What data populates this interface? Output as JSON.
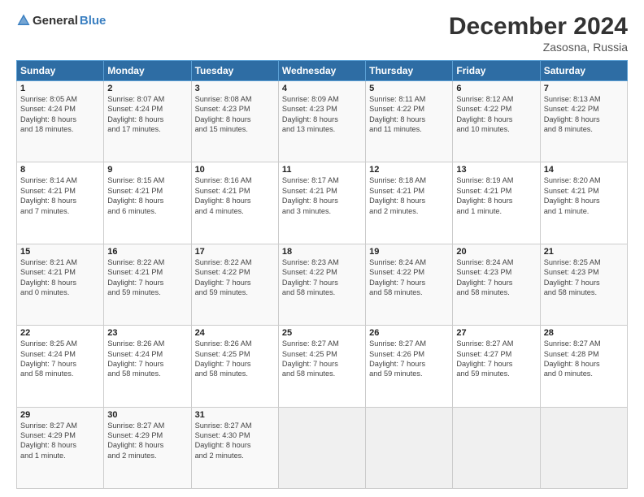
{
  "logo": {
    "general": "General",
    "blue": "Blue"
  },
  "title": "December 2024",
  "subtitle": "Zasosna, Russia",
  "headers": [
    "Sunday",
    "Monday",
    "Tuesday",
    "Wednesday",
    "Thursday",
    "Friday",
    "Saturday"
  ],
  "weeks": [
    [
      {
        "day": "1",
        "info": "Sunrise: 8:05 AM\nSunset: 4:24 PM\nDaylight: 8 hours\nand 18 minutes."
      },
      {
        "day": "2",
        "info": "Sunrise: 8:07 AM\nSunset: 4:24 PM\nDaylight: 8 hours\nand 17 minutes."
      },
      {
        "day": "3",
        "info": "Sunrise: 8:08 AM\nSunset: 4:23 PM\nDaylight: 8 hours\nand 15 minutes."
      },
      {
        "day": "4",
        "info": "Sunrise: 8:09 AM\nSunset: 4:23 PM\nDaylight: 8 hours\nand 13 minutes."
      },
      {
        "day": "5",
        "info": "Sunrise: 8:11 AM\nSunset: 4:22 PM\nDaylight: 8 hours\nand 11 minutes."
      },
      {
        "day": "6",
        "info": "Sunrise: 8:12 AM\nSunset: 4:22 PM\nDaylight: 8 hours\nand 10 minutes."
      },
      {
        "day": "7",
        "info": "Sunrise: 8:13 AM\nSunset: 4:22 PM\nDaylight: 8 hours\nand 8 minutes."
      }
    ],
    [
      {
        "day": "8",
        "info": "Sunrise: 8:14 AM\nSunset: 4:21 PM\nDaylight: 8 hours\nand 7 minutes."
      },
      {
        "day": "9",
        "info": "Sunrise: 8:15 AM\nSunset: 4:21 PM\nDaylight: 8 hours\nand 6 minutes."
      },
      {
        "day": "10",
        "info": "Sunrise: 8:16 AM\nSunset: 4:21 PM\nDaylight: 8 hours\nand 4 minutes."
      },
      {
        "day": "11",
        "info": "Sunrise: 8:17 AM\nSunset: 4:21 PM\nDaylight: 8 hours\nand 3 minutes."
      },
      {
        "day": "12",
        "info": "Sunrise: 8:18 AM\nSunset: 4:21 PM\nDaylight: 8 hours\nand 2 minutes."
      },
      {
        "day": "13",
        "info": "Sunrise: 8:19 AM\nSunset: 4:21 PM\nDaylight: 8 hours\nand 1 minute."
      },
      {
        "day": "14",
        "info": "Sunrise: 8:20 AM\nSunset: 4:21 PM\nDaylight: 8 hours\nand 1 minute."
      }
    ],
    [
      {
        "day": "15",
        "info": "Sunrise: 8:21 AM\nSunset: 4:21 PM\nDaylight: 8 hours\nand 0 minutes."
      },
      {
        "day": "16",
        "info": "Sunrise: 8:22 AM\nSunset: 4:21 PM\nDaylight: 7 hours\nand 59 minutes."
      },
      {
        "day": "17",
        "info": "Sunrise: 8:22 AM\nSunset: 4:22 PM\nDaylight: 7 hours\nand 59 minutes."
      },
      {
        "day": "18",
        "info": "Sunrise: 8:23 AM\nSunset: 4:22 PM\nDaylight: 7 hours\nand 58 minutes."
      },
      {
        "day": "19",
        "info": "Sunrise: 8:24 AM\nSunset: 4:22 PM\nDaylight: 7 hours\nand 58 minutes."
      },
      {
        "day": "20",
        "info": "Sunrise: 8:24 AM\nSunset: 4:23 PM\nDaylight: 7 hours\nand 58 minutes."
      },
      {
        "day": "21",
        "info": "Sunrise: 8:25 AM\nSunset: 4:23 PM\nDaylight: 7 hours\nand 58 minutes."
      }
    ],
    [
      {
        "day": "22",
        "info": "Sunrise: 8:25 AM\nSunset: 4:24 PM\nDaylight: 7 hours\nand 58 minutes."
      },
      {
        "day": "23",
        "info": "Sunrise: 8:26 AM\nSunset: 4:24 PM\nDaylight: 7 hours\nand 58 minutes."
      },
      {
        "day": "24",
        "info": "Sunrise: 8:26 AM\nSunset: 4:25 PM\nDaylight: 7 hours\nand 58 minutes."
      },
      {
        "day": "25",
        "info": "Sunrise: 8:27 AM\nSunset: 4:25 PM\nDaylight: 7 hours\nand 58 minutes."
      },
      {
        "day": "26",
        "info": "Sunrise: 8:27 AM\nSunset: 4:26 PM\nDaylight: 7 hours\nand 59 minutes."
      },
      {
        "day": "27",
        "info": "Sunrise: 8:27 AM\nSunset: 4:27 PM\nDaylight: 7 hours\nand 59 minutes."
      },
      {
        "day": "28",
        "info": "Sunrise: 8:27 AM\nSunset: 4:28 PM\nDaylight: 8 hours\nand 0 minutes."
      }
    ],
    [
      {
        "day": "29",
        "info": "Sunrise: 8:27 AM\nSunset: 4:29 PM\nDaylight: 8 hours\nand 1 minute."
      },
      {
        "day": "30",
        "info": "Sunrise: 8:27 AM\nSunset: 4:29 PM\nDaylight: 8 hours\nand 2 minutes."
      },
      {
        "day": "31",
        "info": "Sunrise: 8:27 AM\nSunset: 4:30 PM\nDaylight: 8 hours\nand 2 minutes."
      },
      null,
      null,
      null,
      null
    ]
  ]
}
